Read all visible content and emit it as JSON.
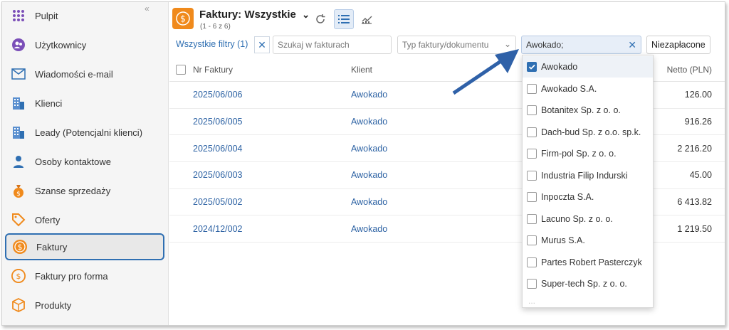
{
  "sidebar": {
    "collapse_label": "«",
    "items": [
      {
        "label": "Pulpit",
        "icon": "dashboard-grid-icon"
      },
      {
        "label": "Użytkownicy",
        "icon": "users-icon"
      },
      {
        "label": "Wiadomości e-mail",
        "icon": "envelope-icon"
      },
      {
        "label": "Klienci",
        "icon": "building-icon"
      },
      {
        "label": "Leady (Potencjalni klienci)",
        "icon": "building-icon"
      },
      {
        "label": "Osoby kontaktowe",
        "icon": "person-icon"
      },
      {
        "label": "Szanse sprzedaży",
        "icon": "money-bag-icon"
      },
      {
        "label": "Oferty",
        "icon": "tag-icon"
      },
      {
        "label": "Faktury",
        "icon": "dollar-coin-icon"
      },
      {
        "label": "Faktury pro forma",
        "icon": "dollar-coin-icon"
      },
      {
        "label": "Produkty",
        "icon": "box-icon"
      }
    ],
    "active_index": 8
  },
  "header": {
    "title": "Faktury: Wszystkie",
    "subtitle": "(1 - 6 z 6)",
    "chevron": "⌄"
  },
  "filters": {
    "all_filters_label": "Wszystkie filtry (1)",
    "search_placeholder": "Szukaj w fakturach",
    "type_placeholder": "Typ faktury/dokumentu",
    "client_value": "Awokado;",
    "unpaid_label": "Niezapłacone"
  },
  "table": {
    "headers": {
      "number": "Nr Faktury",
      "client": "Klient",
      "netto": "Netto (PLN)"
    },
    "rows": [
      {
        "number": "2025/06/006",
        "client": "Awokado",
        "netto": "126.00"
      },
      {
        "number": "2025/06/005",
        "client": "Awokado",
        "netto": "916.26"
      },
      {
        "number": "2025/06/004",
        "client": "Awokado",
        "netto": "2 216.20"
      },
      {
        "number": "2025/06/003",
        "client": "Awokado",
        "netto": "45.00"
      },
      {
        "number": "2025/05/002",
        "client": "Awokado",
        "netto": "6 413.82"
      },
      {
        "number": "2024/12/002",
        "client": "Awokado",
        "netto": "1 219.50"
      }
    ]
  },
  "dropdown": {
    "options": [
      {
        "label": "Awokado",
        "checked": true
      },
      {
        "label": "Awokado S.A.",
        "checked": false
      },
      {
        "label": "Botanitex Sp. z o. o.",
        "checked": false
      },
      {
        "label": "Dach-bud Sp. z o.o. sp.k.",
        "checked": false
      },
      {
        "label": "Firm-pol Sp. z o. o.",
        "checked": false
      },
      {
        "label": "Industria Filip Indurski",
        "checked": false
      },
      {
        "label": "Inpoczta S.A.",
        "checked": false
      },
      {
        "label": "Lacuno Sp. z o. o.",
        "checked": false
      },
      {
        "label": "Murus S.A.",
        "checked": false
      },
      {
        "label": "Partes Robert Pasterczyk",
        "checked": false
      },
      {
        "label": "Super-tech Sp. z o. o.",
        "checked": false
      }
    ],
    "more_label": "..."
  },
  "colors": {
    "accent": "#2f6fb2",
    "orange": "#f08a1c",
    "link": "#2e63a4"
  }
}
